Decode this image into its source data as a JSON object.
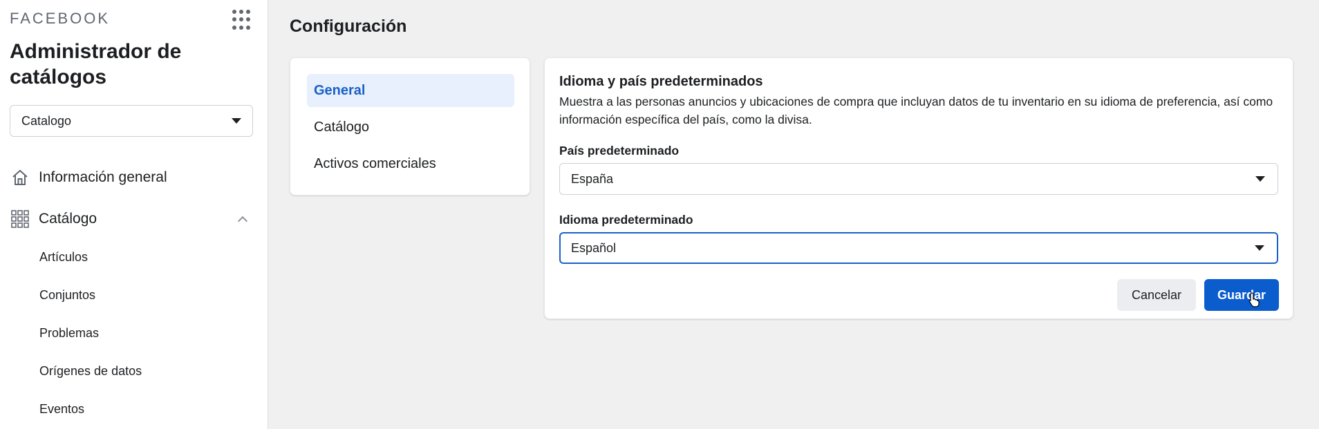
{
  "sidebar": {
    "brand": "FACEBOOK",
    "apps_icon": "grid-dots-icon",
    "title": "Administrador de catálogos",
    "catalog_select": {
      "value": "Catalogo"
    },
    "nav": [
      {
        "label": "Información general",
        "icon": "home-icon"
      },
      {
        "label": "Catálogo",
        "icon": "grid-icon",
        "expanded": true
      }
    ],
    "catalog_subitems": [
      "Artículos",
      "Conjuntos",
      "Problemas",
      "Orígenes de datos",
      "Eventos"
    ]
  },
  "main": {
    "page_title": "Configuración",
    "tabs": [
      {
        "label": "General",
        "active": true
      },
      {
        "label": "Catálogo",
        "active": false
      },
      {
        "label": "Activos comerciales",
        "active": false
      }
    ],
    "section": {
      "title": "Idioma y país predeterminados",
      "description": "Muestra a las personas anuncios y ubicaciones de compra que incluyan datos de tu inventario en su idioma de preferencia, así como información específica del país, como la divisa.",
      "country": {
        "label": "País predeterminado",
        "value": "España"
      },
      "language": {
        "label": "Idioma predeterminado",
        "value": "Español"
      },
      "cancel_label": "Cancelar",
      "save_label": "Guardar"
    }
  },
  "colors": {
    "accent": "#0b5ccd",
    "active_tab_bg": "#e7f0fc",
    "active_tab_text": "#1a61c7",
    "page_bg": "#f0f0f0"
  }
}
